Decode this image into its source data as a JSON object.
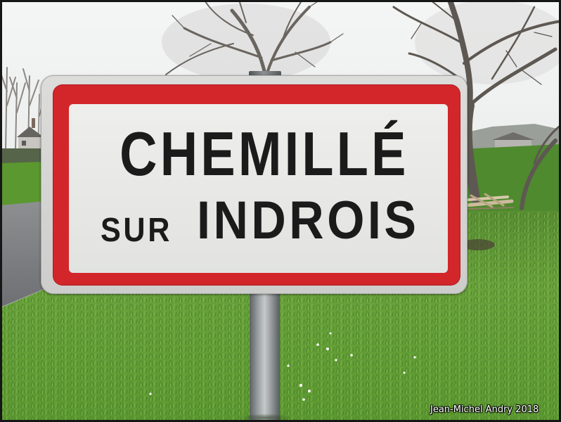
{
  "sign": {
    "line1": "CHEMILLÉ",
    "line2_prefix": "SUR",
    "line2_name": "INDROIS",
    "colors": {
      "border_red": "#d2262b",
      "plate": "#eeeeec",
      "rim": "#dcdcda",
      "lettering": "#1b1b1b"
    }
  },
  "credit": {
    "text": "Jean-Michel Andry 2018"
  }
}
